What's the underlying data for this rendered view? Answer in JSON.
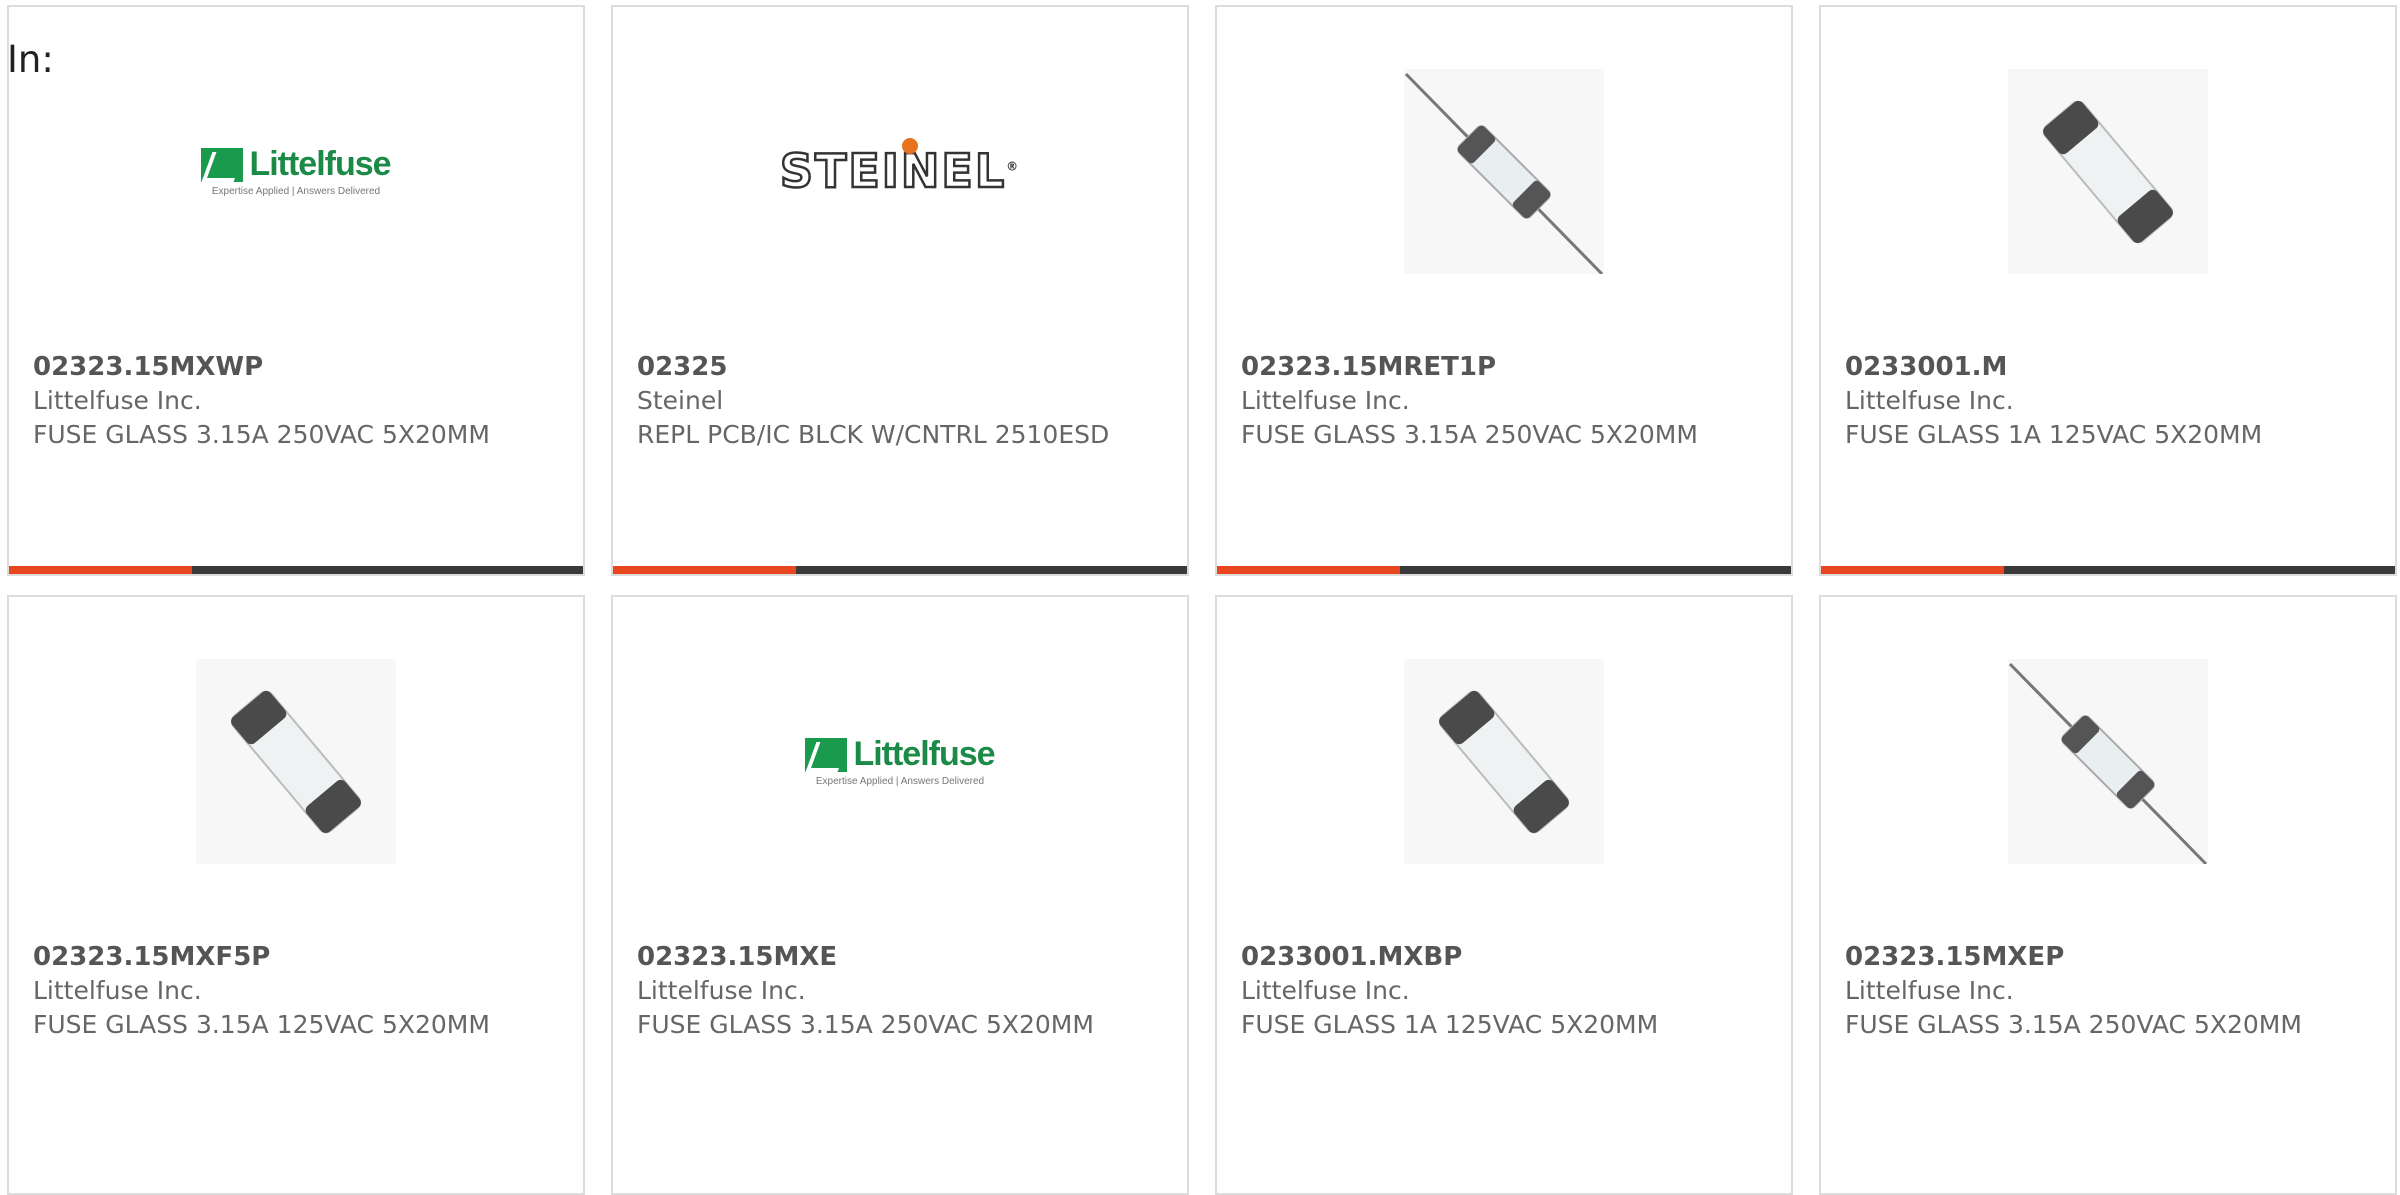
{
  "header": {
    "in_label": "In:"
  },
  "products": [
    {
      "part_number": "02323.15MXWP",
      "manufacturer": "Littelfuse Inc.",
      "description": "FUSE GLASS 3.15A 250VAC 5X20MM",
      "image": "littelfuse-logo"
    },
    {
      "part_number": "02325",
      "manufacturer": "Steinel",
      "description": "REPL PCB/IC BLCK W/CNTRL 2510ESD",
      "image": "steinel-logo"
    },
    {
      "part_number": "02323.15MRET1P",
      "manufacturer": "Littelfuse Inc.",
      "description": "FUSE GLASS 3.15A 250VAC 5X20MM",
      "image": "axial-fuse-photo"
    },
    {
      "part_number": "0233001.M",
      "manufacturer": "Littelfuse Inc.",
      "description": "FUSE GLASS 1A 125VAC 5X20MM",
      "image": "cartridge-fuse-photo"
    },
    {
      "part_number": "02323.15MXF5P",
      "manufacturer": "Littelfuse Inc.",
      "description": "FUSE GLASS 3.15A 125VAC 5X20MM",
      "image": "cartridge-fuse-photo"
    },
    {
      "part_number": "02323.15MXE",
      "manufacturer": "Littelfuse Inc.",
      "description": "FUSE GLASS 3.15A 250VAC 5X20MM",
      "image": "littelfuse-logo"
    },
    {
      "part_number": "0233001.MXBP",
      "manufacturer": "Littelfuse Inc.",
      "description": "FUSE GLASS 1A 125VAC 5X20MM",
      "image": "cartridge-fuse-photo"
    },
    {
      "part_number": "02323.15MXEP",
      "manufacturer": "Littelfuse Inc.",
      "description": "FUSE GLASS 3.15A 250VAC 5X20MM",
      "image": "axial-fuse-photo"
    }
  ],
  "logos": {
    "littelfuse_word": "Littelfuse",
    "littelfuse_tagline": "Expertise Applied | Answers Delivered",
    "steinel_word": "STEINEL"
  },
  "colors": {
    "accent": "#e8461e",
    "bar": "#3a3a3a",
    "brand_green": "#1a8a46"
  }
}
